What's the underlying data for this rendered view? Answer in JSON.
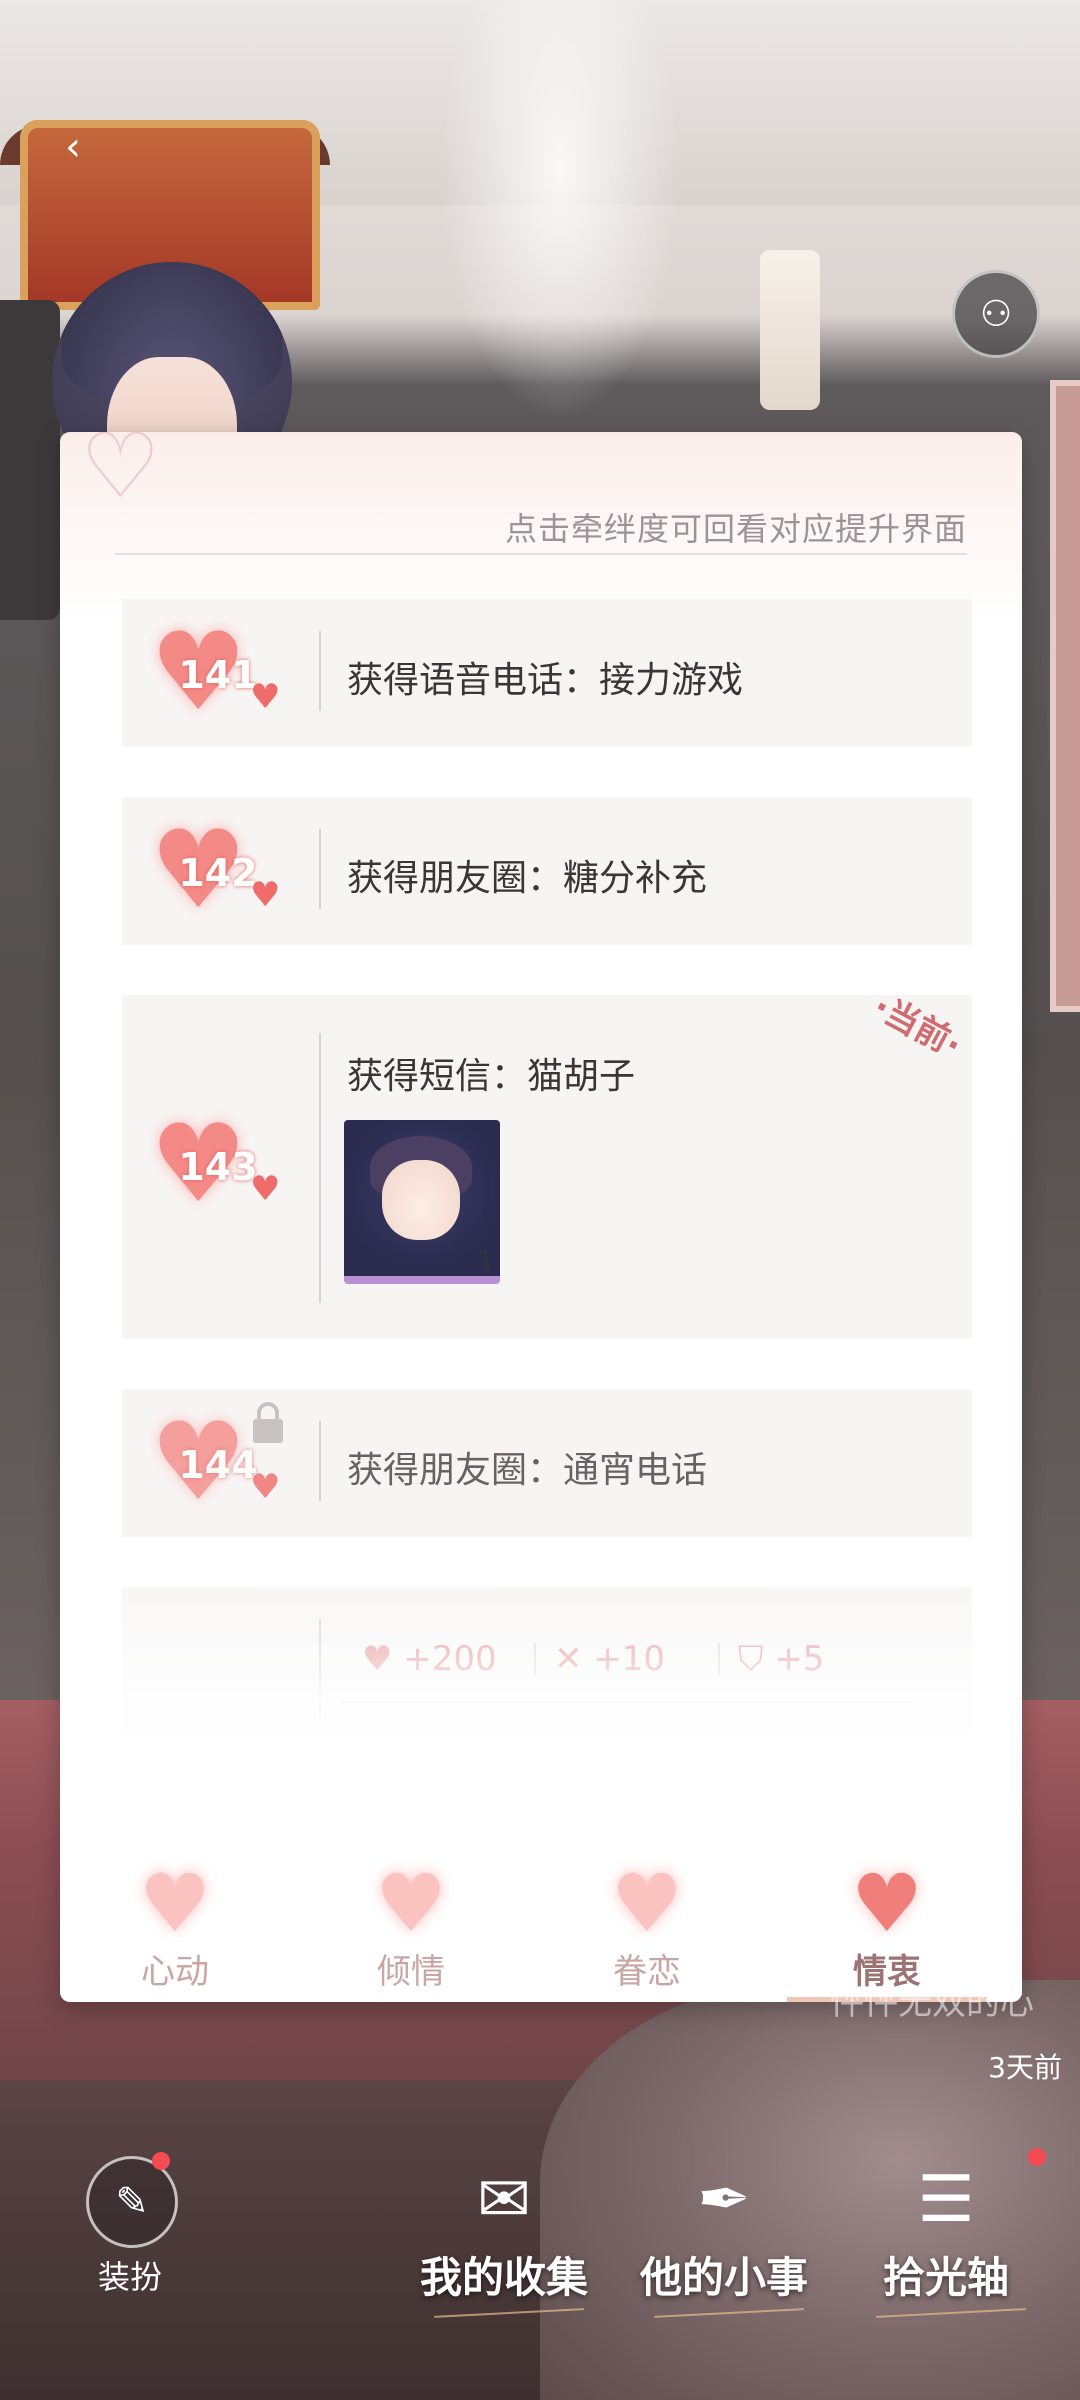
{
  "hint": "点击牵绊度可回看对应提升界面",
  "items": [
    {
      "level": "141",
      "text": "获得语音电话：接力游戏",
      "locked": false,
      "current": false
    },
    {
      "level": "142",
      "text": "获得朋友圈：糖分补充",
      "locked": false,
      "current": false
    },
    {
      "level": "143",
      "text": "获得短信：猫胡子",
      "locked": false,
      "current": true,
      "badge": "·当前·",
      "sticker_count": "1"
    },
    {
      "level": "144",
      "text": "获得朋友圈：通宵电话",
      "locked": true,
      "current": false
    }
  ],
  "rewards": [
    {
      "icon": "heart-icon",
      "value": "+200"
    },
    {
      "icon": "cross-swords-icon",
      "value": "+10"
    },
    {
      "icon": "shield-icon",
      "value": "+5"
    }
  ],
  "tabs": [
    {
      "label": "心动",
      "active": false
    },
    {
      "label": "倾情",
      "active": false
    },
    {
      "label": "眷恋",
      "active": false
    },
    {
      "label": "情衷",
      "active": true
    }
  ],
  "side": {
    "text": "怦怦无双的心",
    "timestamp": "3天前"
  },
  "bottom": {
    "dress_label": "装扮",
    "collection_label": "我的收集",
    "his_things_label": "他的小事",
    "timeline_label": "拾光轴"
  },
  "colors": {
    "accent": "#f48a86",
    "tab_active": "#9b7473",
    "badge": "#d06b6f"
  }
}
